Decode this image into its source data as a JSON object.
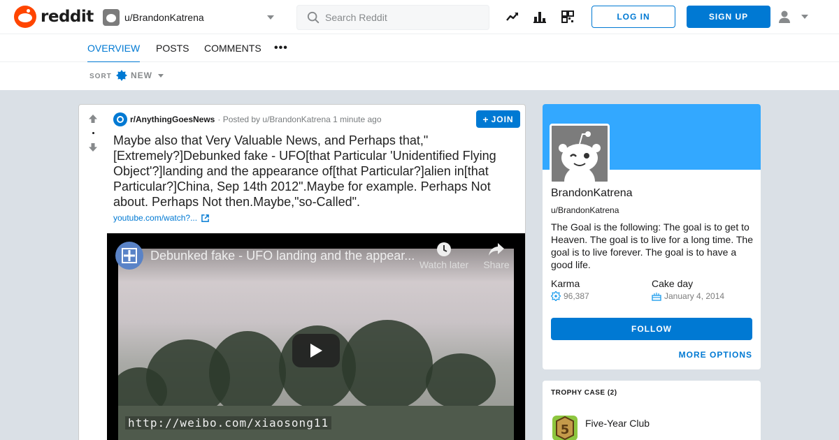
{
  "header": {
    "logo_text": "reddit",
    "user_switcher": "u/BrandonKatrena",
    "search_placeholder": "Search Reddit",
    "login": "LOG IN",
    "signup": "SIGN UP"
  },
  "tabs": {
    "overview": "OVERVIEW",
    "posts": "POSTS",
    "comments": "COMMENTS",
    "more": "•••"
  },
  "sort": {
    "label": "SORT",
    "value": "NEW"
  },
  "post": {
    "subreddit": "r/AnythingGoesNews",
    "posted_by": "· Posted by u/BrandonKatrena 1 minute ago",
    "join": "JOIN",
    "title": "Maybe also that Very Valuable News, and Perhaps that,\" [Extremely?]Debunked fake - UFO[that Particular 'Unidentified Flying Object'?]landing and the appearance of[that Particular?]alien in[that Particular?]China, Sep 14th 2012\".Maybe for example. Perhaps Not about. Perhaps Not then.Maybe,\"so-Called\".",
    "link": "youtube.com/watch?...",
    "video": {
      "title": "Debunked fake - UFO landing and the appear...",
      "watch_later": "Watch later",
      "share": "Share",
      "watermark": "http://weibo.com/xiaosong11"
    }
  },
  "profile": {
    "display_name": "BrandonKatrena",
    "handle": "u/BrandonKatrena",
    "bio": "The Goal is the following: The goal is to get to Heaven. The goal is to live for a long time. The goal is to live forever. The goal is to have a good life.",
    "karma_label": "Karma",
    "karma_value": "96,387",
    "cakeday_label": "Cake day",
    "cakeday_value": "January 4, 2014",
    "follow": "FOLLOW",
    "more_options": "MORE OPTIONS"
  },
  "trophies": {
    "heading": "TROPHY CASE (2)",
    "items": [
      {
        "name": "Five-Year Club"
      }
    ]
  },
  "colors": {
    "brand": "#ff4500",
    "accent": "#0079d3",
    "banner": "#33a8ff"
  }
}
